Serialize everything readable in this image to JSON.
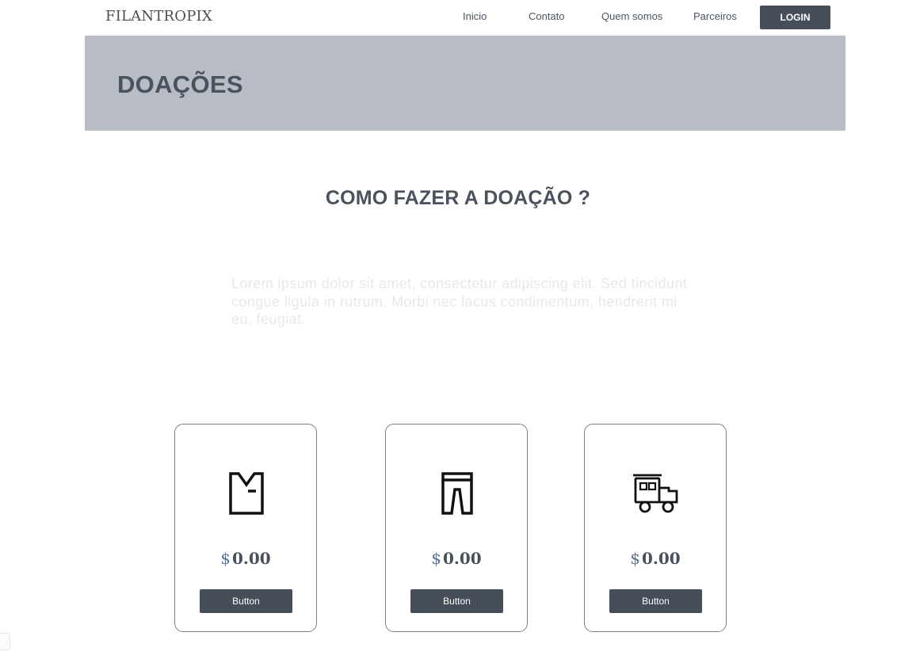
{
  "brand": "FILANTROPIX",
  "nav": {
    "items": [
      {
        "label": "Inicio"
      },
      {
        "label": "Contato"
      },
      {
        "label": "Quem somos"
      },
      {
        "label": "Parceiros"
      }
    ],
    "login_label": "LOGIN"
  },
  "hero": {
    "title": "DOAÇÕES"
  },
  "section": {
    "title": "COMO FAZER  A DOAÇÃO ?",
    "description": "Lorem ipsum dolor sit amet, consectetur adipiscing elit. Sed tincidunt congue ligula in rutrum. Morbi nec lacus condimentum, hendrerit mi eu, feugiat."
  },
  "cards": [
    {
      "icon": "shirt-icon",
      "currency": "$",
      "amount": "0.00",
      "button_label": "Button"
    },
    {
      "icon": "pants-icon",
      "currency": "$",
      "amount": "0.00",
      "button_label": "Button"
    },
    {
      "icon": "toy-train-icon",
      "currency": "$",
      "amount": "0.00",
      "button_label": "Button"
    }
  ],
  "colors": {
    "button_bg": "#454e59",
    "hero_bg": "#b8bdc5",
    "heading_text": "#4a525e",
    "currency_accent": "#5b7296"
  }
}
